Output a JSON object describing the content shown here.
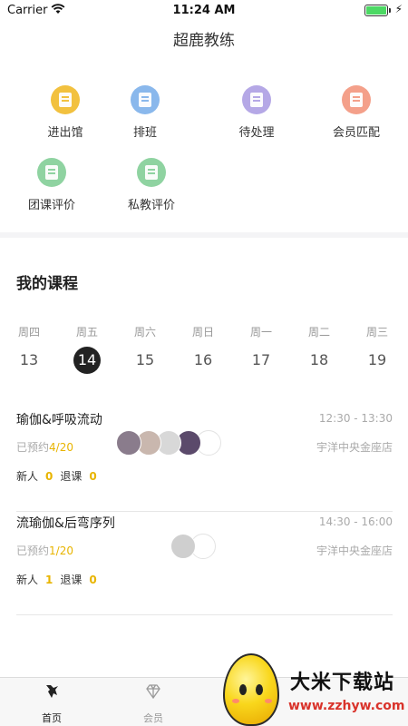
{
  "status_bar": {
    "carrier": "Carrier",
    "time": "11:24 AM",
    "battery_level": 1.0
  },
  "header": {
    "title": "超鹿教练"
  },
  "menu": [
    {
      "label": "进出馆",
      "icon": "door-icon",
      "color": "#f2c13f"
    },
    {
      "label": "排班",
      "icon": "schedule-icon",
      "color": "#8ab8ec"
    },
    {
      "label": "待处理",
      "icon": "pending-doc-icon",
      "color": "#b5a8e6"
    },
    {
      "label": "会员匹配",
      "icon": "member-match-icon",
      "color": "#f4a08a"
    },
    {
      "label": "团课评价",
      "icon": "comment-icon",
      "color": "#8fd3a1"
    },
    {
      "label": "私教评价",
      "icon": "comment-icon",
      "color": "#8fd3a1"
    }
  ],
  "courses_section": {
    "title": "我的课程",
    "days": [
      {
        "dow": "周四",
        "date": "13"
      },
      {
        "dow": "周五",
        "date": "14",
        "selected": true
      },
      {
        "dow": "周六",
        "date": "15"
      },
      {
        "dow": "周日",
        "date": "16"
      },
      {
        "dow": "周一",
        "date": "17"
      },
      {
        "dow": "周二",
        "date": "18"
      },
      {
        "dow": "周三",
        "date": "19"
      }
    ],
    "courses": [
      {
        "name": "瑜伽&呼吸流动",
        "time": "12:30 - 13:30",
        "booked_label": "已预约",
        "booked_count": "4/20",
        "store": "宇洋中央金座店",
        "new_label": "新人",
        "new_value": "0",
        "drop_label": "退课",
        "drop_value": "0",
        "avatar_colors": [
          "#8a7c8c",
          "#c9b7ae",
          "#d8d8d8",
          "#5b4a6b"
        ]
      },
      {
        "name": "流瑜伽&后弯序列",
        "time": "14:30 - 16:00",
        "booked_label": "已预约",
        "booked_count": "1/20",
        "store": "宇洋中央金座店",
        "new_label": "新人",
        "new_value": "1",
        "drop_label": "退课",
        "drop_value": "0",
        "avatar_colors": [
          "#cfcfcf"
        ]
      }
    ]
  },
  "tabbar": {
    "tabs": [
      {
        "label": "首页",
        "icon": "home-deer-icon",
        "active": true
      },
      {
        "label": "会员",
        "icon": "diamond-icon",
        "active": false
      }
    ]
  },
  "watermark": {
    "title": "大米下载站",
    "url": "www.zzhyw.com"
  }
}
